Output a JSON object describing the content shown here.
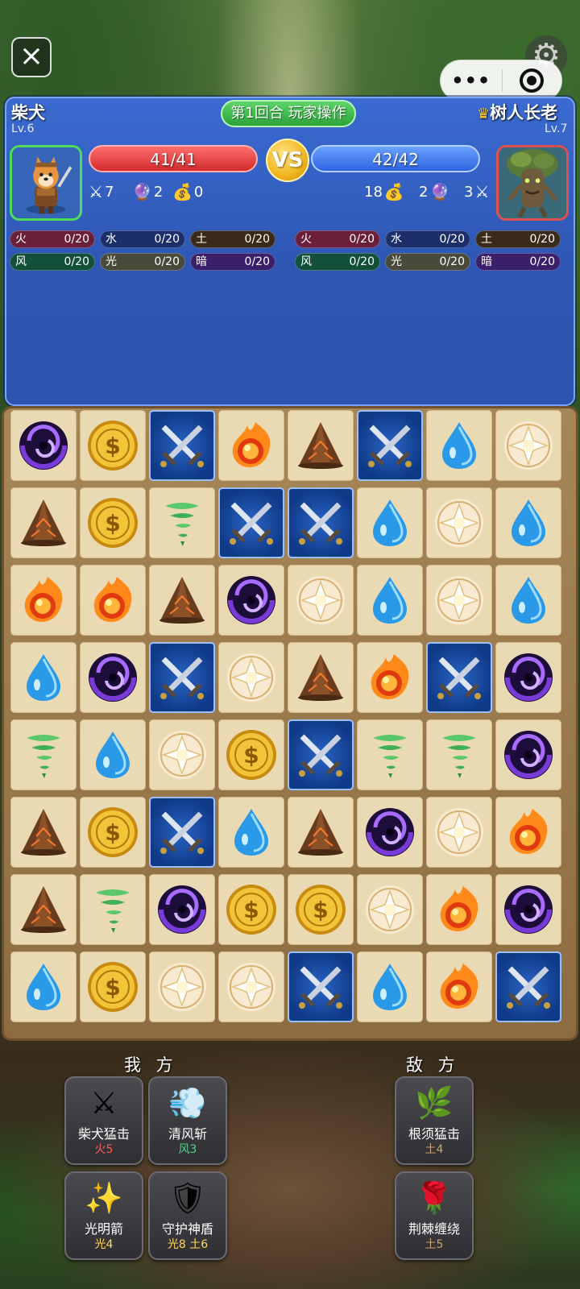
{
  "top": {
    "close_icon": "close-icon",
    "settings_icon": "gear-icon",
    "more_icon": "more-dots-icon",
    "target_icon": "target-icon"
  },
  "round_label": "第1回合 玩家操作",
  "vs_label": "VS",
  "player": {
    "name": "柴犬",
    "level": "Lv.6",
    "hp": "41/41",
    "attack": "7",
    "magic": "2",
    "gold": "0",
    "elements": [
      {
        "name": "火",
        "value": "0/20",
        "color": "#6b1f3a"
      },
      {
        "name": "水",
        "value": "0/20",
        "color": "#1d2f6b"
      },
      {
        "name": "土",
        "value": "0/20",
        "color": "#3a2a1a"
      },
      {
        "name": "风",
        "value": "0/20",
        "color": "#12503a"
      },
      {
        "name": "光",
        "value": "0/20",
        "color": "#4a4a3a"
      },
      {
        "name": "暗",
        "value": "0/20",
        "color": "#3a1f6b"
      }
    ]
  },
  "enemy": {
    "name": "树人长老",
    "level": "Lv.7",
    "hp": "42/42",
    "gold": "18",
    "magic": "2",
    "attack": "3",
    "elements": [
      {
        "name": "火",
        "value": "0/20",
        "color": "#6b1f3a"
      },
      {
        "name": "水",
        "value": "0/20",
        "color": "#1d2f6b"
      },
      {
        "name": "土",
        "value": "0/20",
        "color": "#3a2a1a"
      },
      {
        "name": "风",
        "value": "0/20",
        "color": "#12503a"
      },
      {
        "name": "光",
        "value": "0/20",
        "color": "#4a4a3a"
      },
      {
        "name": "暗",
        "value": "0/20",
        "color": "#3a1f6b"
      }
    ]
  },
  "board": [
    [
      "dark",
      "gold",
      "sword",
      "fire",
      "earth",
      "sword",
      "water",
      "light"
    ],
    [
      "earth",
      "gold",
      "wind",
      "sword",
      "sword",
      "water",
      "light",
      "water"
    ],
    [
      "fire",
      "fire",
      "earth",
      "dark",
      "light",
      "water",
      "light",
      "water"
    ],
    [
      "water",
      "dark",
      "sword",
      "light",
      "earth",
      "fire",
      "sword",
      "dark"
    ],
    [
      "wind",
      "water",
      "light",
      "gold",
      "sword",
      "wind",
      "wind",
      "dark"
    ],
    [
      "earth",
      "gold",
      "sword",
      "water",
      "earth",
      "dark",
      "light",
      "fire"
    ],
    [
      "earth",
      "wind",
      "dark",
      "gold",
      "gold",
      "light",
      "fire",
      "dark"
    ],
    [
      "water",
      "gold",
      "light",
      "light",
      "sword",
      "water",
      "fire",
      "sword"
    ]
  ],
  "skills": {
    "ally_label": "我 方",
    "enemy_label": "敌 方",
    "ally": [
      {
        "name": "柴犬猛击",
        "cost": "火5",
        "icon": "crossed-swords-icon",
        "glyph": "⚔",
        "cost_color": "#ff5a5a"
      },
      {
        "name": "清风斩",
        "cost": "风3",
        "icon": "wind-gust-icon",
        "glyph": "💨",
        "cost_color": "#55d28a"
      },
      {
        "name": "光明箭",
        "cost": "光4",
        "icon": "sparkle-icon",
        "glyph": "✨",
        "cost_color": "#ffd75a"
      },
      {
        "name": "守护神盾",
        "cost": "光8 土6",
        "icon": "shield-icon",
        "glyph": "🛡",
        "cost_color": "#ffd75a"
      }
    ],
    "enemy": [
      {
        "name": "根须猛击",
        "cost": "土4",
        "icon": "sprout-icon",
        "glyph": "🌿",
        "cost_color": "#c9a36a"
      },
      {
        "name": "荆棘缠绕",
        "cost": "土5",
        "icon": "rose-icon",
        "glyph": "🌹",
        "cost_color": "#c9a36a"
      }
    ]
  }
}
